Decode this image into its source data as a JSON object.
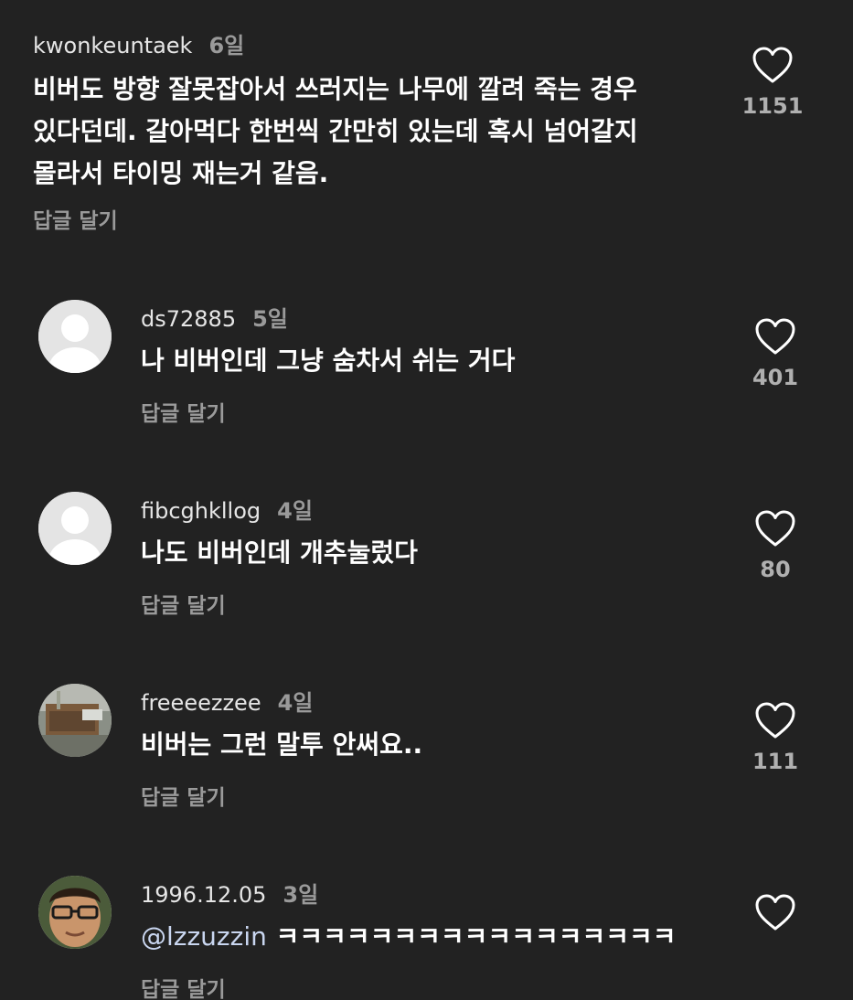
{
  "comments": [
    {
      "username": "kwonkeuntaek",
      "time": "6일",
      "lines": [
        "비버도 방향 잘못잡아서 쓰러지는 나무에 깔려 죽는 경우",
        "있다던데. 갈아먹다 한번씩 간만히 있는데 혹시 넘어갈지",
        "몰라서 타이밍 재는거 같음."
      ],
      "reply_label": "답글 달기",
      "likes": "1151"
    },
    {
      "username": "ds72885",
      "time": "5일",
      "lines": [
        "나 비버인데 그냥 숨차서 쉬는 거다"
      ],
      "reply_label": "답글 달기",
      "likes": "401",
      "avatar": "default-avatar"
    },
    {
      "username": "fibcghkllog",
      "time": "4일",
      "lines": [
        "나도 비버인데 개추눌렀다"
      ],
      "reply_label": "답글 달기",
      "likes": "80",
      "avatar": "default-avatar"
    },
    {
      "username": "freeeezzee",
      "time": "4일",
      "lines": [
        "비버는 그런 말투 안써요.."
      ],
      "reply_label": "답글 달기",
      "likes": "111",
      "avatar": "photo-avatar"
    },
    {
      "username": "1996.12.05",
      "time": "3일",
      "mention": "@lzzuzzin",
      "text": "ㅋㅋㅋㅋㅋㅋㅋㅋㅋㅋㅋㅋㅋㅋㅋㅋㅋ",
      "reply_label": "답글 달기",
      "likes": "",
      "avatar": "photo-avatar"
    }
  ],
  "colors": {
    "background": "#222222",
    "text_primary": "#ffffff",
    "text_secondary": "#9a9a9a",
    "mention": "#c9d6f0"
  },
  "icons": {
    "like": "heart-outline-icon",
    "avatar_default": "person-silhouette-icon"
  }
}
